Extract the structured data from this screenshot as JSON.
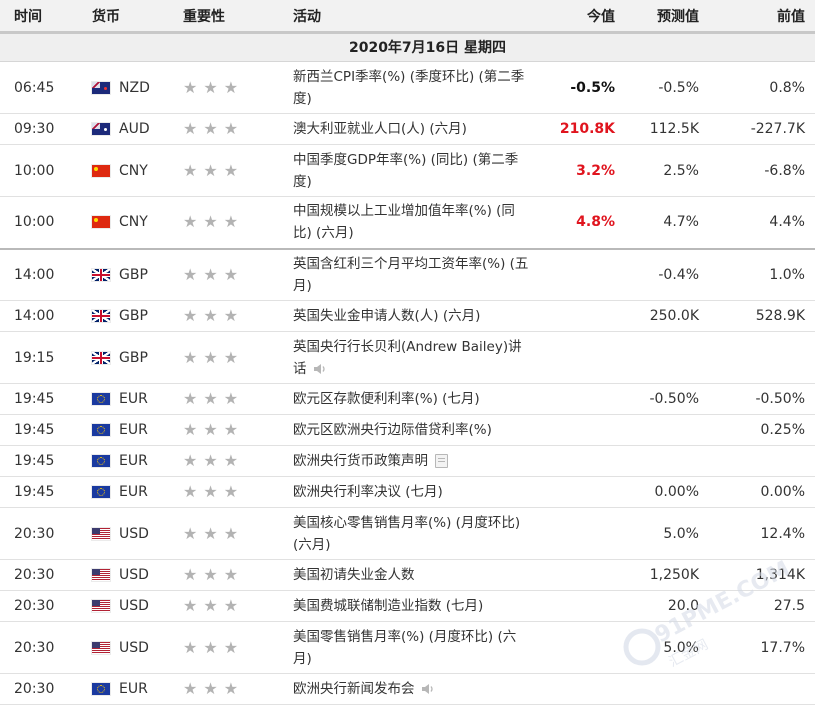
{
  "headers": {
    "time": "时间",
    "currency": "货币",
    "importance": "重要性",
    "event": "活动",
    "actual": "今值",
    "forecast": "预测值",
    "previous": "前值"
  },
  "date_label": "2020年7月16日  星期四",
  "rows": [
    {
      "time": "06:45",
      "currency": "NZD",
      "flag": "nz-flag",
      "event": "新西兰CPI季率(%) (季度环比) (第二季度)",
      "actual": "-0.5%",
      "actual_color": "black",
      "forecast": "-0.5%",
      "previous": "0.8%"
    },
    {
      "time": "09:30",
      "currency": "AUD",
      "flag": "au-flag",
      "event": "澳大利亚就业人口(人) (六月)",
      "actual": "210.8K",
      "actual_color": "red",
      "forecast": "112.5K",
      "previous": "-227.7K"
    },
    {
      "time": "10:00",
      "currency": "CNY",
      "flag": "cn-flag",
      "event": "中国季度GDP年率(%) (同比) (第二季度)",
      "actual": "3.2%",
      "actual_color": "red",
      "forecast": "2.5%",
      "previous": "-6.8%"
    },
    {
      "time": "10:00",
      "currency": "CNY",
      "flag": "cn-flag",
      "event": "中国规模以上工业增加值年率(%) (同比) (六月)",
      "actual": "4.8%",
      "actual_color": "red",
      "forecast": "4.7%",
      "previous": "4.4%"
    },
    {
      "time": "14:00",
      "currency": "GBP",
      "flag": "gb-flag",
      "event": "英国含红利三个月平均工资年率(%) (五月)",
      "actual": "",
      "forecast": "-0.4%",
      "previous": "1.0%"
    },
    {
      "time": "14:00",
      "currency": "GBP",
      "flag": "gb-flag",
      "event": "英国失业金申请人数(人) (六月)",
      "actual": "",
      "forecast": "250.0K",
      "previous": "528.9K"
    },
    {
      "time": "19:15",
      "currency": "GBP",
      "flag": "gb-flag",
      "event": "英国央行行长贝利(Andrew Bailey)讲话",
      "icon": "speaker-icon",
      "actual": "",
      "forecast": "",
      "previous": ""
    },
    {
      "time": "19:45",
      "currency": "EUR",
      "flag": "eu-flag",
      "event": "欧元区存款便利利率(%) (七月)",
      "actual": "",
      "forecast": "-0.50%",
      "previous": "-0.50%"
    },
    {
      "time": "19:45",
      "currency": "EUR",
      "flag": "eu-flag",
      "event": "欧元区欧洲央行边际借贷利率(%)",
      "actual": "",
      "forecast": "",
      "previous": "0.25%"
    },
    {
      "time": "19:45",
      "currency": "EUR",
      "flag": "eu-flag",
      "event": "欧洲央行货币政策声明",
      "icon": "document-icon",
      "actual": "",
      "forecast": "",
      "previous": ""
    },
    {
      "time": "19:45",
      "currency": "EUR",
      "flag": "eu-flag",
      "event": "欧洲央行利率决议 (七月)",
      "actual": "",
      "forecast": "0.00%",
      "previous": "0.00%"
    },
    {
      "time": "20:30",
      "currency": "USD",
      "flag": "us-flag",
      "event": "美国核心零售销售月率(%) (月度环比) (六月)",
      "actual": "",
      "forecast": "5.0%",
      "previous": "12.4%"
    },
    {
      "time": "20:30",
      "currency": "USD",
      "flag": "us-flag",
      "event": "美国初请失业金人数",
      "actual": "",
      "forecast": "1,250K",
      "previous": "1,314K"
    },
    {
      "time": "20:30",
      "currency": "USD",
      "flag": "us-flag",
      "event": "美国费城联储制造业指数 (七月)",
      "actual": "",
      "forecast": "20.0",
      "previous": "27.5"
    },
    {
      "time": "20:30",
      "currency": "USD",
      "flag": "us-flag",
      "event": "美国零售销售月率(%) (月度环比) (六月)",
      "actual": "",
      "forecast": "5.0%",
      "previous": "17.7%"
    },
    {
      "time": "20:30",
      "currency": "EUR",
      "flag": "eu-flag",
      "event": "欧洲央行新闻发布会",
      "icon": "speaker-icon",
      "actual": "",
      "forecast": "",
      "previous": ""
    }
  ],
  "importance_stars": 3,
  "colors": {
    "actual_red": "#e0141e",
    "star_gray": "#b3b3b3",
    "header_bg": "#f2f2f2"
  },
  "watermark": {
    "text": "91PME.COM",
    "subtext": "汇金网",
    "icon": "watermark-logo"
  }
}
